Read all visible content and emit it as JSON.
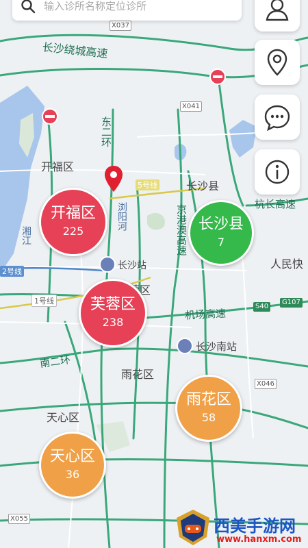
{
  "search": {
    "placeholder": "输入诊所名称定位诊所"
  },
  "side_buttons": [
    {
      "icon": "user-icon"
    },
    {
      "icon": "location-pin-icon"
    },
    {
      "icon": "chat-bubble-icon"
    },
    {
      "icon": "info-icon"
    }
  ],
  "clusters": [
    {
      "name": "开福区",
      "count": "225",
      "color": "#e64156"
    },
    {
      "name": "长沙县",
      "count": "7",
      "color": "#34b94a"
    },
    {
      "name": "芙蓉区",
      "count": "238",
      "color": "#e64156"
    },
    {
      "name": "雨花区",
      "count": "58",
      "color": "#f0a046"
    },
    {
      "name": "天心区",
      "count": "36",
      "color": "#f0a046"
    }
  ],
  "map_labels": {
    "kaifu": "开福区",
    "changsha_county": "长沙县",
    "furong": "蓉区",
    "yuhua": "雨花区",
    "tianxin": "天心区",
    "renmin": "人民快",
    "changsha_station": "长沙站",
    "changsha_south": "长沙南站"
  },
  "road_labels": {
    "raocheng": "长沙绕城高速",
    "dong_er_huan": "东二环",
    "jinggangao": "京港澳高速",
    "hangchang": "杭长高速",
    "jichang": "机场高速",
    "nan_er_huan": "南二环",
    "line5": "5号线",
    "line1": "1号线",
    "line2": "2号线",
    "xiang_jiang": "湘江",
    "liuyang_he": "浏阳河"
  },
  "shields": {
    "x037": "X037",
    "x041": "X041",
    "x046": "X046",
    "x055": "X055",
    "s40": "S40",
    "g107": "G107"
  },
  "watermark": {
    "title": "西美手游网",
    "url": "www.hanxm.com"
  }
}
